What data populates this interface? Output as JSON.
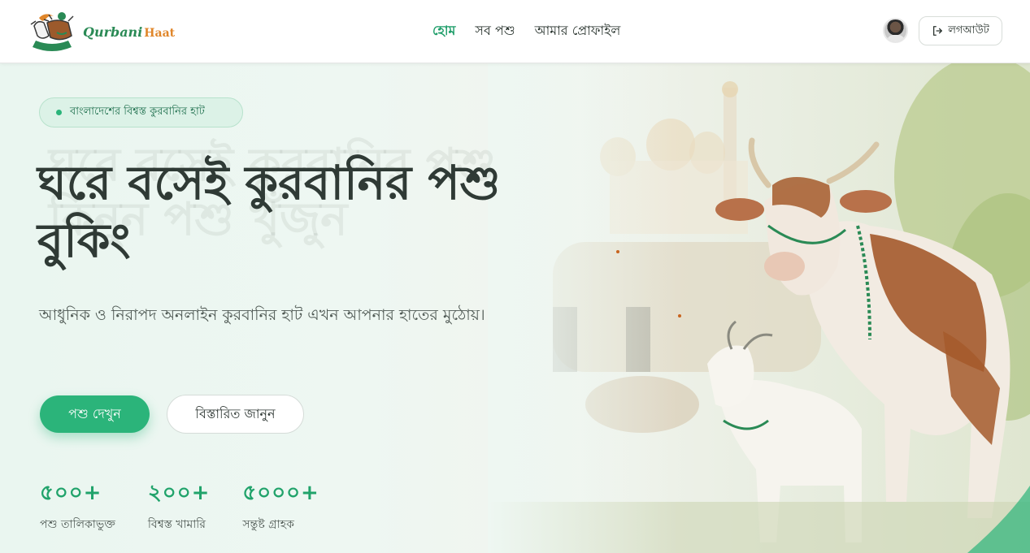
{
  "brand": {
    "name_part1": "Qurbani",
    "name_part2": "Haat",
    "logo_icon": "cow-goat-crescent-logo",
    "colors": {
      "green": "#2a8a55",
      "orange": "#e0862a"
    }
  },
  "nav": {
    "items": [
      {
        "label": "হোম",
        "active": true
      },
      {
        "label": "সব পশু",
        "active": false
      },
      {
        "label": "আমার প্রোফাইল",
        "active": false
      }
    ]
  },
  "user": {
    "avatar_icon": "user-avatar",
    "logout_label": "লগআউট",
    "logout_icon": "logout-icon"
  },
  "hero": {
    "badge": "বাংলাদেশের বিশ্বস্ত কুরবানির হাট",
    "ghost_text_line1": "ঘরে বসেই কুরবানির পশু",
    "ghost_text_line2": "কিনুন পশু খুঁজুন",
    "title_line1": "ঘরে বসেই কুরবানির পশু",
    "title_line2": "বুকিং",
    "subtitle": "আধুনিক ও নিরাপদ অনলাইন কুরবানির হাট এখন আপনার হাতের মুঠোয়।",
    "primary_button": "পশু দেখুন",
    "secondary_button": "বিস্তারিত জানুন",
    "image_icon": "cow-goat-market-illustration"
  },
  "stats": [
    {
      "value": "৫০০+",
      "label": "পশু তালিকাভুক্ত"
    },
    {
      "value": "২০০+",
      "label": "বিশ্বস্ত খামারি"
    },
    {
      "value": "৫০০০+",
      "label": "সন্তুষ্ট গ্রাহক"
    }
  ],
  "colors": {
    "accent": "#2bb47a",
    "text_dark": "#2f3a35"
  }
}
